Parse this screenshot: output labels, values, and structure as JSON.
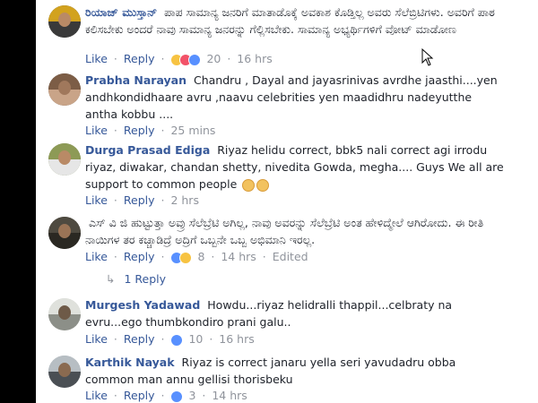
{
  "comments": [
    {
      "name": "ರಿಯಾಜ್ ಮುಸ್ತಾನ್",
      "text": "ಪಾಪ ಸಾಮಾನ್ಯ ಜನರಿಗೆ ಮಾತಾಡೊಕ್ಕೆ ಅವಕಾಶ ಕೊಡ್ತಿಲ್ಲ ಅವರು ಸೆಲೆಬ್ರಿಟಿಗಳು. ಅವರಿಗೆ ಪಾಠ ಕಲಿಸಬೇಕು ಅಂದರೆ ನಾವು ಸಾಮಾನ್ಯ ಜನರನ್ನು ಗೆಲ್ಲಿಸಬೇಕು. ಸಾಮಾನ್ಯ ಅಭ್ಯರ್ಥಿಗಳಿಗೆ ವೋಟ್ ಮಾಡೋಣ",
      "like": "Like",
      "reply": "Reply",
      "count": "20",
      "time": "16 hrs",
      "edited": ""
    },
    {
      "name": "Prabha Narayan",
      "text": "Chandru , Dayal and jayasrinivas avrdhe jaasthi....yen andhkondidhaare avru ,naavu celebrities yen maadidhru nadeyutthe antha kobbu ....",
      "like": "Like",
      "reply": "Reply",
      "count": "",
      "time": "25 mins",
      "edited": ""
    },
    {
      "name": "Durga Prasad Ediga",
      "text": "Riyaz helidu correct, bbk5 nali correct agi irrodu riyaz, diwakar, chandan shetty, nivedita Gowda, megha.... Guys We all are support to common people",
      "like": "Like",
      "reply": "Reply",
      "count": "",
      "time": "2 hrs",
      "edited": ""
    },
    {
      "name": "",
      "text": "ಎಸ್ ವಿ ಜಿ ಹುಟ್ಟುತ್ತಾ ಅವ್ರು ಸೆಲೆಬ್ರೆಟಿ ಅಗಿಲ್ಲ, ನಾವು ಅವರನ್ನು ಸೆಲೆಬ್ರೆಟಿ ಅಂತ ಹೇಳಿದ್ಮೇಲೆ ಆಗಿರೋದು. ಈ ರೀತಿ ನಾಯಿಗಳ ತರ ಕಚ್ಚಾಡಿದ್ರೆ ಅದ್ರಿಗೆ ಒಬ್ಬನೇ ಒಬ್ಬ ಅಭಿಮಾನಿ ಇರಲ್ಲ.",
      "like": "Like",
      "reply": "Reply",
      "count": "8",
      "time": "14 hrs",
      "edited": "Edited",
      "replies": "1 Reply"
    },
    {
      "name": "Murgesh Yadawad",
      "text": "Howdu...riyaz helidralli thappil...celbraty na evru...ego thumbkondiro prani galu..",
      "like": "Like",
      "reply": "Reply",
      "count": "10",
      "time": "16 hrs",
      "edited": ""
    },
    {
      "name": "Karthik Nayak",
      "text": "Riyaz is correct janaru yella seri yavudadru obba common man annu gellisi thorisbeku",
      "like": "Like",
      "reply": "Reply",
      "count": "3",
      "time": "14 hrs",
      "edited": ""
    }
  ],
  "separator": "·",
  "colors": {
    "link": "#365899",
    "meta": "#90949c",
    "text": "#1d2129"
  }
}
